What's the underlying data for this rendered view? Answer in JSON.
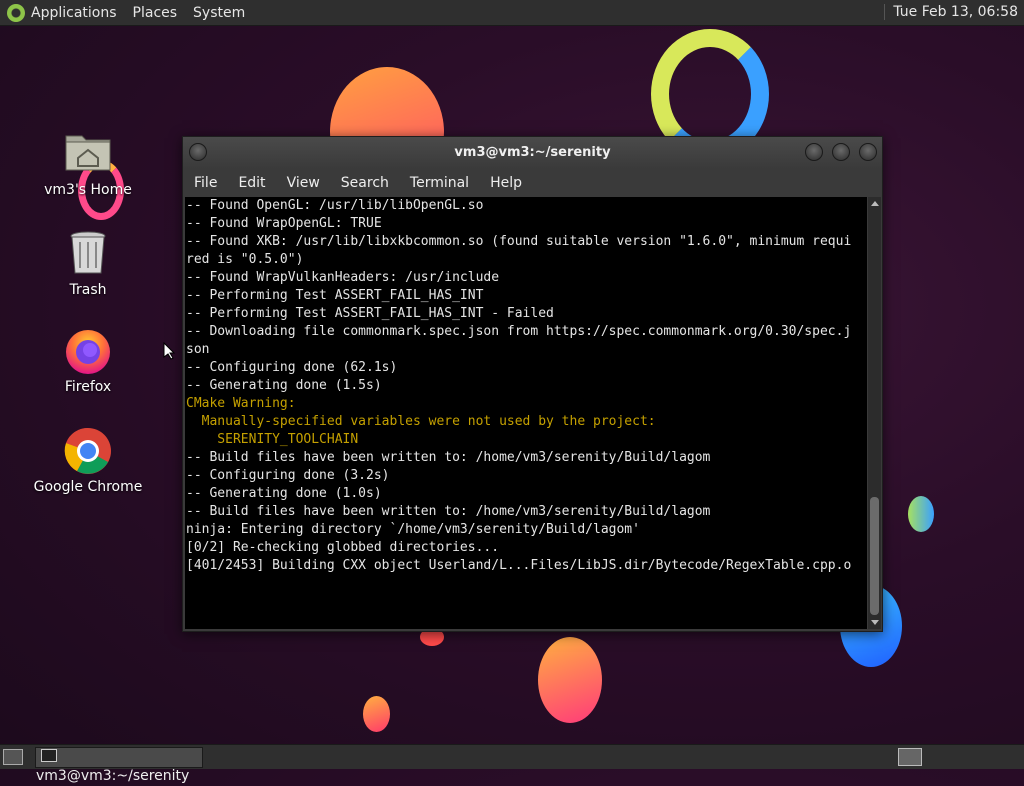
{
  "top_panel": {
    "menus": [
      "Applications",
      "Places",
      "System"
    ],
    "clock": "Tue Feb 13, 06:58"
  },
  "desktop": {
    "icons": [
      {
        "label": "vm3's Home",
        "icon": "home-folder-icon"
      },
      {
        "label": "Trash",
        "icon": "trash-icon"
      },
      {
        "label": "Firefox",
        "icon": "firefox-icon"
      },
      {
        "label": "Google Chrome",
        "icon": "chrome-icon"
      }
    ]
  },
  "window": {
    "title": "vm3@vm3:~/serenity",
    "menus": [
      "File",
      "Edit",
      "View",
      "Search",
      "Terminal",
      "Help"
    ],
    "lines": [
      {
        "text": "-- Found OpenGL: /usr/lib/libOpenGL.so",
        "style": "normal"
      },
      {
        "text": "-- Found WrapOpenGL: TRUE",
        "style": "normal"
      },
      {
        "text": "-- Found XKB: /usr/lib/libxkbcommon.so (found suitable version \"1.6.0\", minimum requi",
        "style": "normal"
      },
      {
        "text": "red is \"0.5.0\")",
        "style": "normal"
      },
      {
        "text": "-- Found WrapVulkanHeaders: /usr/include",
        "style": "normal"
      },
      {
        "text": "-- Performing Test ASSERT_FAIL_HAS_INT",
        "style": "normal"
      },
      {
        "text": "-- Performing Test ASSERT_FAIL_HAS_INT - Failed",
        "style": "normal"
      },
      {
        "text": "-- Downloading file commonmark.spec.json from https://spec.commonmark.org/0.30/spec.j",
        "style": "normal"
      },
      {
        "text": "son",
        "style": "normal"
      },
      {
        "text": "-- Configuring done (62.1s)",
        "style": "normal"
      },
      {
        "text": "-- Generating done (1.5s)",
        "style": "normal"
      },
      {
        "text": "CMake Warning:",
        "style": "warn"
      },
      {
        "text": "  Manually-specified variables were not used by the project:",
        "style": "warn"
      },
      {
        "text": "",
        "style": "warn"
      },
      {
        "text": "    SERENITY_TOOLCHAIN",
        "style": "warn"
      },
      {
        "text": "",
        "style": "normal"
      },
      {
        "text": "",
        "style": "normal"
      },
      {
        "text": "-- Build files have been written to: /home/vm3/serenity/Build/lagom",
        "style": "normal"
      },
      {
        "text": "-- Configuring done (3.2s)",
        "style": "normal"
      },
      {
        "text": "-- Generating done (1.0s)",
        "style": "normal"
      },
      {
        "text": "-- Build files have been written to: /home/vm3/serenity/Build/lagom",
        "style": "normal"
      },
      {
        "text": "ninja: Entering directory `/home/vm3/serenity/Build/lagom'",
        "style": "normal"
      },
      {
        "text": "[0/2] Re-checking globbed directories...",
        "style": "normal"
      },
      {
        "text": "[401/2453] Building CXX object Userland/L...Files/LibJS.dir/Bytecode/RegexTable.cpp.o",
        "style": "normal"
      }
    ]
  },
  "taskbar": {
    "task_label": "vm3@vm3:~/serenity"
  }
}
